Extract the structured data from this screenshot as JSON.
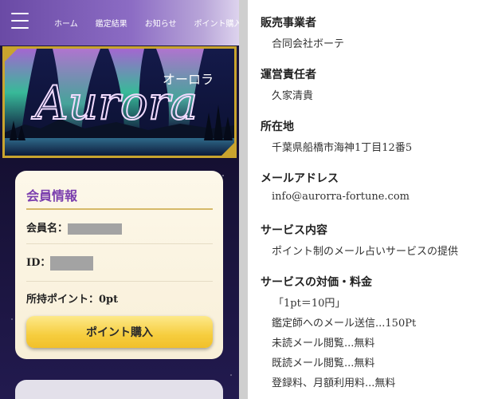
{
  "header": {
    "nav": [
      "ホーム",
      "鑑定結果",
      "お知らせ",
      "ポイント購入"
    ]
  },
  "hero": {
    "logo_text": "Aurora",
    "kana": "オーロラ"
  },
  "member": {
    "title": "会員情報",
    "name_label": "会員名：",
    "id_label": "ID：",
    "points_label": "所持ポイント：",
    "points_value": "0pt",
    "buy_button": "ポイント購入"
  },
  "colors": {
    "header_start": "#6a4aa5",
    "accent_purple": "#7b3fae",
    "gold": "#c9a42e",
    "button_yellow": "#f6cd3e"
  },
  "legal": {
    "sections": [
      {
        "heading": "販売事業者",
        "lines": [
          "合同会社ボーテ"
        ]
      },
      {
        "heading": "運営責任者",
        "lines": [
          "久家清貴"
        ]
      },
      {
        "heading": "所在地",
        "lines": [
          "千葉県船橋市海神1丁目12番5"
        ]
      },
      {
        "heading": "メールアドレス",
        "lines": [
          "info@aurorra-fortune.com"
        ]
      },
      {
        "heading": "サービス内容",
        "lines": [
          "ポイント制のメール占いサービスの提供"
        ]
      },
      {
        "heading": "サービスの対価・料金",
        "lines": [
          "「1pt＝10円」",
          "鑑定師へのメール送信...150Pt",
          "未読メール閲覧...無料",
          "既読メール閲覧...無料",
          "登録料、月額利用料...無料"
        ]
      }
    ]
  }
}
